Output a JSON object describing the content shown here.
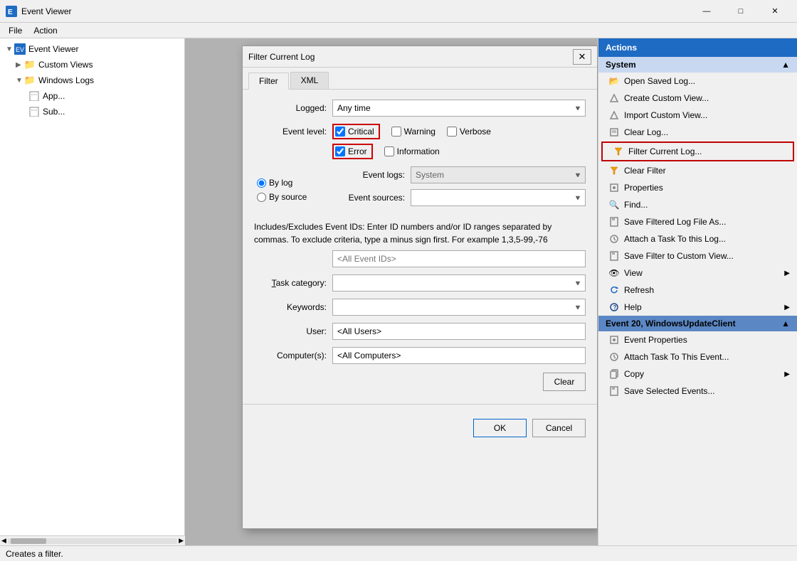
{
  "window": {
    "title": "Event Viewer",
    "icon": "ev"
  },
  "menubar": {
    "items": [
      "File",
      "Action"
    ]
  },
  "sidebar": {
    "items": [
      {
        "label": "Event Viewer",
        "level": 0,
        "icon": "ev",
        "expanded": true
      },
      {
        "label": "Custom Views",
        "level": 1,
        "icon": "folder",
        "expanded": true
      },
      {
        "label": "Windows Logs",
        "level": 1,
        "icon": "folder",
        "expanded": true
      },
      {
        "label": "App...",
        "level": 2,
        "icon": "page"
      },
      {
        "label": "Sub...",
        "level": 2,
        "icon": "page"
      }
    ]
  },
  "actions": {
    "title": "Actions",
    "system_section": "System",
    "items": [
      {
        "label": "Open Saved Log...",
        "icon": "📂"
      },
      {
        "label": "Create Custom View...",
        "icon": "🔽"
      },
      {
        "label": "Import Custom View...",
        "icon": "📥"
      },
      {
        "label": "Clear Log...",
        "icon": "📋"
      },
      {
        "label": "Filter Current Log...",
        "icon": "🔽",
        "highlighted": true
      },
      {
        "label": "Clear Filter",
        "icon": "🔽"
      },
      {
        "label": "Properties",
        "icon": "📄"
      },
      {
        "label": "Find...",
        "icon": "🔍"
      },
      {
        "label": "Save Filtered Log File As...",
        "icon": "💾"
      },
      {
        "label": "Attach a Task To this Log...",
        "icon": "📎"
      },
      {
        "label": "Save Filter to Custom View...",
        "icon": "💾"
      },
      {
        "label": "View",
        "icon": "👁",
        "hasArrow": true
      },
      {
        "label": "Refresh",
        "icon": "🔄"
      },
      {
        "label": "Help",
        "icon": "❓",
        "hasArrow": true
      }
    ],
    "event_section": "Event 20, WindowsUpdateClient",
    "event_items": [
      {
        "label": "Event Properties",
        "icon": "📄"
      },
      {
        "label": "Attach Task To This Event...",
        "icon": "🔄"
      },
      {
        "label": "Copy",
        "icon": "📋",
        "hasArrow": true
      },
      {
        "label": "Save Selected Events...",
        "icon": "💾"
      }
    ]
  },
  "dialog": {
    "title": "Filter Current Log",
    "tabs": [
      "Filter",
      "XML"
    ],
    "active_tab": "Filter",
    "logged_label": "Logged:",
    "logged_value": "Any time",
    "event_level_label": "Event level:",
    "checkboxes": [
      {
        "id": "critical",
        "label": "Critical",
        "checked": true,
        "bordered": true
      },
      {
        "id": "warning",
        "label": "Warning",
        "checked": false,
        "bordered": false
      },
      {
        "id": "verbose",
        "label": "Verbose",
        "checked": false,
        "bordered": false
      },
      {
        "id": "error",
        "label": "Error",
        "checked": true,
        "bordered": true
      },
      {
        "id": "information",
        "label": "Information",
        "checked": false,
        "bordered": false
      }
    ],
    "radio_options": [
      "By log",
      "By source"
    ],
    "radio_selected": "By log",
    "event_logs_label": "Event logs:",
    "event_logs_value": "System",
    "event_sources_label": "Event sources:",
    "event_sources_value": "",
    "description": "Includes/Excludes Event IDs: Enter ID numbers and/or ID ranges separated by commas. To exclude criteria, type a minus sign first. For example 1,3,5-99,-76",
    "event_ids_placeholder": "<All Event IDs>",
    "task_category_label": "Task category:",
    "keywords_label": "Keywords:",
    "user_label": "User:",
    "user_value": "<All Users>",
    "computer_label": "Computer(s):",
    "computer_value": "<All Computers>",
    "clear_button": "Clear",
    "ok_button": "OK",
    "cancel_button": "Cancel"
  },
  "statusbar": {
    "text": "Creates a filter."
  }
}
